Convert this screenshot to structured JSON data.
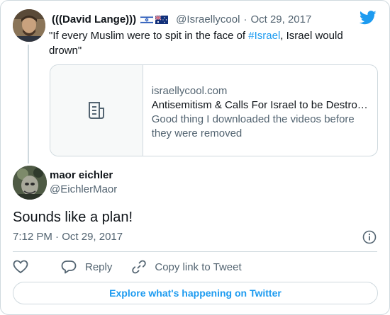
{
  "parent_tweet": {
    "author_name": "(((David Lange)))",
    "flag_icons": [
      "israel-flag-icon",
      "australia-flag-icon"
    ],
    "handle": "@Israellycool",
    "separator": "·",
    "date": "Oct 29, 2017",
    "text_before": "\"If every Muslim were to spit in the face of ",
    "hashtag": "#Israel",
    "text_after": ", Israel would drown\"",
    "link_card": {
      "domain": "israellycool.com",
      "title": "Antisemitism & Calls For Israel to be Destro…",
      "description": "Good thing I downloaded the videos before they were removed",
      "thumbnail_icon": "article-icon"
    }
  },
  "reply_tweet": {
    "author_name": "maor eichler",
    "handle": "@EichlerMaor",
    "text": "Sounds like a plan!",
    "time": "7:12 PM",
    "separator": "·",
    "date": "Oct 29, 2017"
  },
  "actions": {
    "like_icon": "heart-icon",
    "reply_label": "Reply",
    "copy_link_label": "Copy link to Tweet"
  },
  "explore_button": "Explore what's happening on Twitter",
  "colors": {
    "accent": "#1d9bf0",
    "text_primary": "#0f1419",
    "text_secondary": "#536471",
    "border": "#cfd9de"
  }
}
